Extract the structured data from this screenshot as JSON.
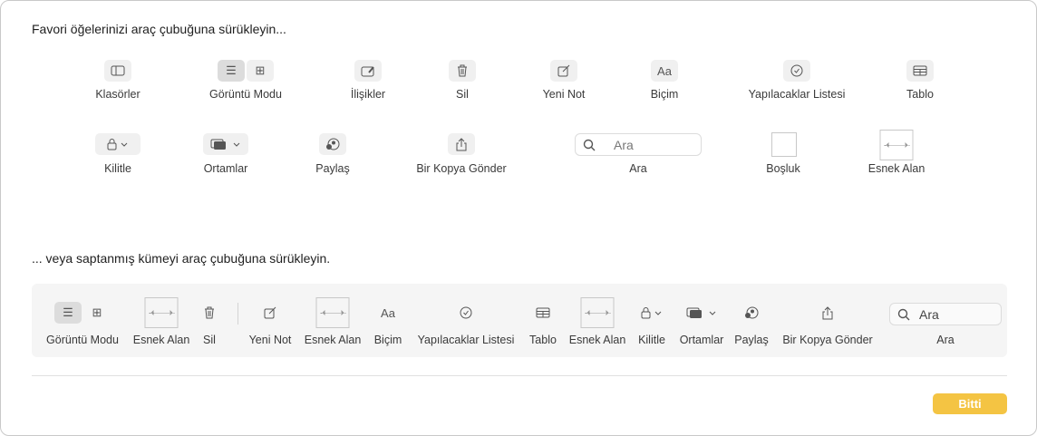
{
  "heading_top": "Favori öğelerinizi araç çubuğuna sürükleyin...",
  "heading_bottom": "... veya saptanmış kümeyi araç çubuğuna sürükleyin.",
  "items": {
    "folders": "Klasörler",
    "view_mode": "Görüntü Modu",
    "attachments": "İlişikler",
    "delete": "Sil",
    "new_note": "Yeni Not",
    "format": "Biçim",
    "checklist": "Yapılacaklar Listesi",
    "table": "Tablo",
    "lock": "Kilitle",
    "media": "Ortamlar",
    "share": "Paylaş",
    "send_copy": "Bir Kopya Gönder",
    "search": "Ara",
    "space": "Boşluk",
    "flexible_space": "Esnek Alan"
  },
  "search_placeholder": "Ara",
  "format_glyph": "Aa",
  "done_label": "Bitti",
  "accent_color": "#f4c443"
}
